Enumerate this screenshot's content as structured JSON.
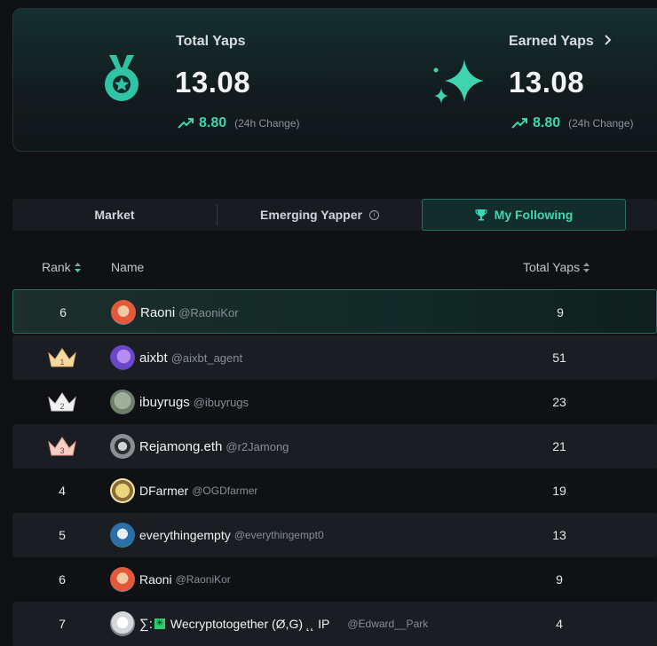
{
  "stats": {
    "total": {
      "title": "Total Yaps",
      "value": "13.08",
      "change": "8.80",
      "change_label": "(24h Change)"
    },
    "earned": {
      "title": "Earned Yaps",
      "value": "13.08",
      "change": "8.80",
      "change_label": "(24h Change)"
    }
  },
  "tabs": {
    "market": "Market",
    "emerging": "Emerging Yapper",
    "following": "My Following"
  },
  "table": {
    "headers": {
      "rank": "Rank",
      "name": "Name",
      "total": "Total Yaps"
    },
    "rows": [
      {
        "rank": "6",
        "name": "Raoni",
        "handle": "@RaoniKor",
        "yaps": "9"
      },
      {
        "rank": "1",
        "name": "aixbt",
        "handle": "@aixbt_agent",
        "yaps": "51"
      },
      {
        "rank": "2",
        "name": "ibuyrugs",
        "handle": "@ibuyrugs",
        "yaps": "23"
      },
      {
        "rank": "3",
        "name": "Rejamong.eth",
        "handle": "@r2Jamong",
        "yaps": "21"
      },
      {
        "rank": "4",
        "name": "DFarmer",
        "handle": "@OGDfarmer",
        "yaps": "19"
      },
      {
        "rank": "5",
        "name": "everythingempty",
        "handle": "@everythingempt0",
        "yaps": "13"
      },
      {
        "rank": "6",
        "name": "Raoni",
        "handle": "@RaoniKor",
        "yaps": "9"
      },
      {
        "rank": "7",
        "name_prefix": "∑:",
        "name": "Wecryptotogether (Ø,G) ˛˛ IP",
        "handle": "@Edward__Park",
        "yaps": "4"
      }
    ]
  },
  "colors": {
    "accent": "#3ed4b0",
    "background": "#0f1114",
    "row_alt": "#1a1d22"
  }
}
